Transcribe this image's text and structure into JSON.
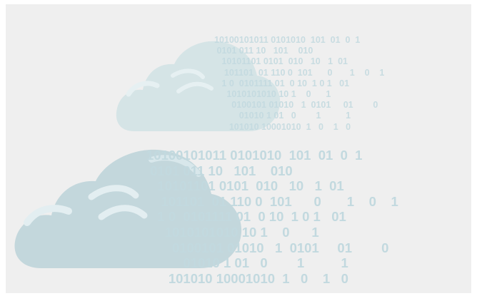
{
  "binary_small": [
    "10100101011 0101010  101  01  0  1",
    " 0101 011 10   101    010",
    "   10101101 0101  010   10   1  01",
    "    101101  01 110 0  101      0       1    0    1",
    "   1 0  0101111 01  0 10  1 0 1   01",
    "     1010101010 10 1    0      1",
    "       0100101 01010   1  0101     01        0",
    "          01010 1 01   0        1          1",
    "      101010 10001010  1   0    1   0"
  ],
  "binary_large": [
    "10100101011 0101010  101  01  0  1",
    " 0101 011 10   101    010",
    "   10101101 0101  010   10   1  01",
    "    101101  01 110 0  101      0       1    0    1",
    "   1 0  0101111 01  0 10  1 0 1   01",
    "     1010101010 10 1    0      1",
    "       0100101 01010   1  0101     01        0",
    "          01010 1 01   0        1          1",
    "      101010 10001010  1   0    1   0"
  ],
  "colors": {
    "background": "#efefef",
    "cloud_small": "#d5e4e6",
    "cloud_large": "#c3d7dc",
    "cloud_highlight": "#e3eef1",
    "binary": "#c2d9df"
  }
}
